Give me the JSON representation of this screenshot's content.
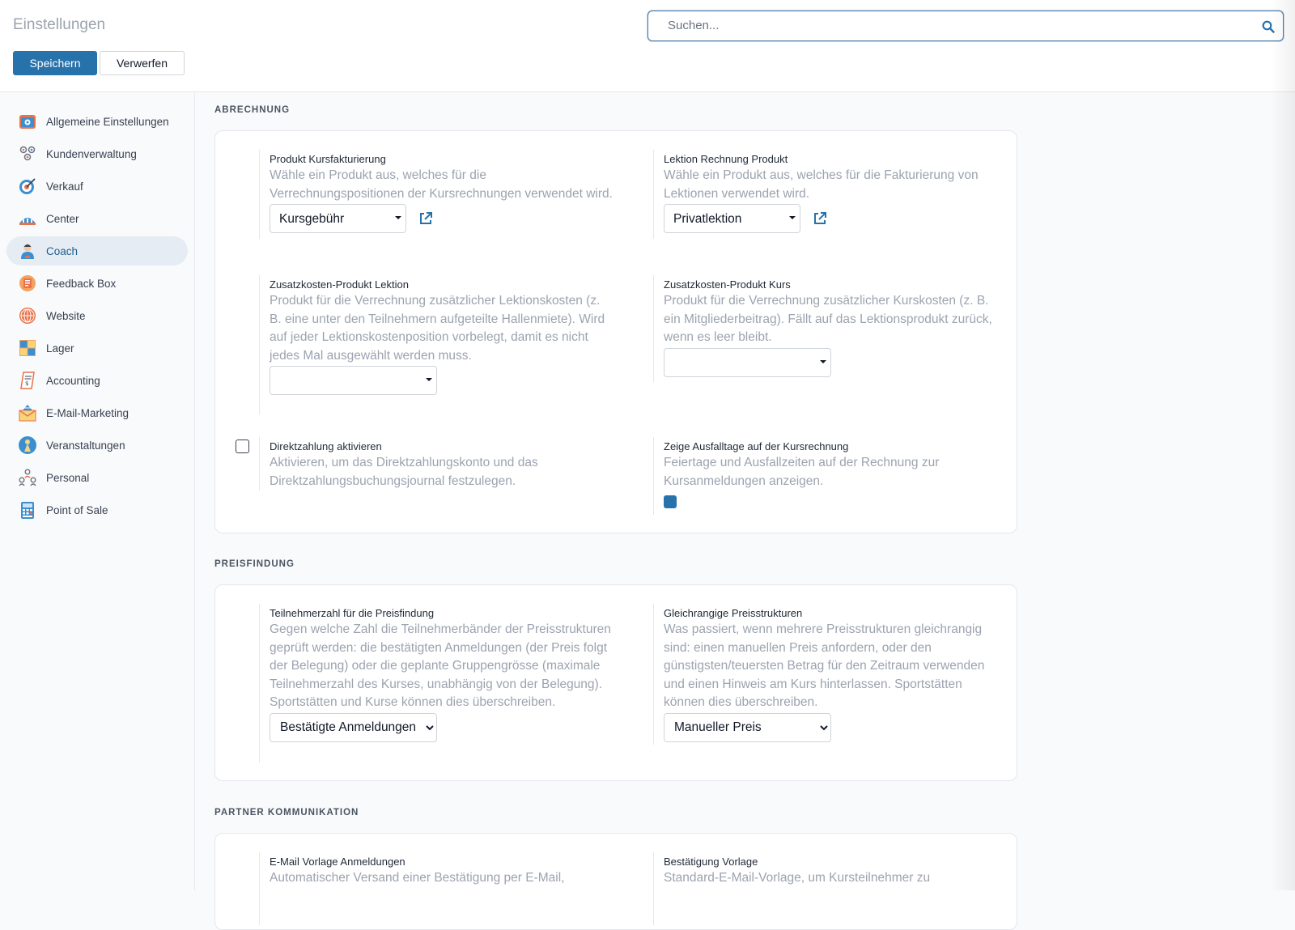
{
  "header": {
    "title": "Einstellungen",
    "save_label": "Speichern",
    "discard_label": "Verwerfen",
    "search_placeholder": "Suchen..."
  },
  "sidebar": {
    "items": [
      {
        "label": "Allgemeine Einstellungen",
        "icon": "settings-icon"
      },
      {
        "label": "Kundenverwaltung",
        "icon": "customers-icon"
      },
      {
        "label": "Verkauf",
        "icon": "target-icon"
      },
      {
        "label": "Center",
        "icon": "building-icon"
      },
      {
        "label": "Coach",
        "icon": "coach-icon"
      },
      {
        "label": "Feedback Box",
        "icon": "feedback-icon"
      },
      {
        "label": "Website",
        "icon": "globe-icon"
      },
      {
        "label": "Lager",
        "icon": "warehouse-icon"
      },
      {
        "label": "Accounting",
        "icon": "invoice-icon"
      },
      {
        "label": "E-Mail-Marketing",
        "icon": "mail-icon"
      },
      {
        "label": "Veranstaltungen",
        "icon": "event-icon"
      },
      {
        "label": "Personal",
        "icon": "people-icon"
      },
      {
        "label": "Point of Sale",
        "icon": "pos-icon"
      }
    ],
    "active_index": 4
  },
  "sections": {
    "billing": {
      "title": "Abrechnung",
      "course_product": {
        "label": "Produkt Kursfakturierung",
        "desc": "Wähle ein Produkt aus, welches für die Verrechnungspositionen der Kursrechnungen verwendet wird.",
        "value": "Kursgebühr"
      },
      "lesson_product": {
        "label": "Lektion Rechnung Produkt",
        "desc": "Wähle ein Produkt aus, welches für die Fakturierung von Lektionen verwendet wird.",
        "value": "Privatlektion"
      },
      "extra_lesson": {
        "label": "Zusatzkosten-Produkt Lektion",
        "desc": "Produkt für die Verrechnung zusätzlicher Lektionskosten (z. B. eine unter den Teilnehmern aufgeteilte Hallenmiete). Wird auf jeder Lektionskostenposition vorbelegt, damit es nicht jedes Mal ausgewählt werden muss.",
        "value": ""
      },
      "extra_course": {
        "label": "Zusatzkosten-Produkt Kurs",
        "desc": "Produkt für die Verrechnung zusätzlicher Kurskosten (z. B. ein Mitgliederbeitrag). Fällt auf das Lektionsprodukt zurück, wenn es leer bleibt.",
        "value": ""
      },
      "direct_payment": {
        "label": "Direktzahlung aktivieren",
        "desc": "Aktivieren, um das Direktzahlungskonto und das Direktzahlungsbuchungsjournal festzulegen.",
        "checked": false
      },
      "show_absences": {
        "label": "Zeige Ausfalltage auf der Kursrechnung",
        "desc": "Feiertage und Ausfallzeiten auf der Rechnung zur Kursanmeldungen anzeigen.",
        "checked": true
      }
    },
    "pricing": {
      "title": "Preisfindung",
      "participants": {
        "label": "Teilnehmerzahl für die Preisfindung",
        "desc": "Gegen welche Zahl die Teilnehmerbänder der Preisstrukturen geprüft werden: die bestätigten Anmeldungen (der Preis folgt der Belegung) oder die geplante Gruppengrösse (maximale Teilnehmerzahl des Kurses, unabhängig von der Belegung). Sportstätten und Kurse können dies überschreiben.",
        "value": "Bestätigte Anmeldungen"
      },
      "equal_rank": {
        "label": "Gleichrangige Preisstrukturen",
        "desc": "Was passiert, wenn mehrere Preisstrukturen gleichrangig sind: einen manuellen Preis anfordern, oder den günstigsten/teuersten Betrag für den Zeitraum verwenden und einen Hinweis am Kurs hinterlassen. Sportstätten können dies überschreiben.",
        "value": "Manueller Preis"
      }
    },
    "partner": {
      "title": "Partner Kommunikation",
      "email_template": {
        "label": "E-Mail Vorlage Anmeldungen",
        "desc": "Automatischer Versand einer Bestätigung per E-Mail,"
      },
      "confirmation": {
        "label": "Bestätigung Vorlage",
        "desc": "Standard-E-Mail-Vorlage, um Kursteilnehmer zu"
      }
    }
  },
  "colors": {
    "accent": "#2872ab",
    "active_nav_bg": "#e6ecf3"
  }
}
